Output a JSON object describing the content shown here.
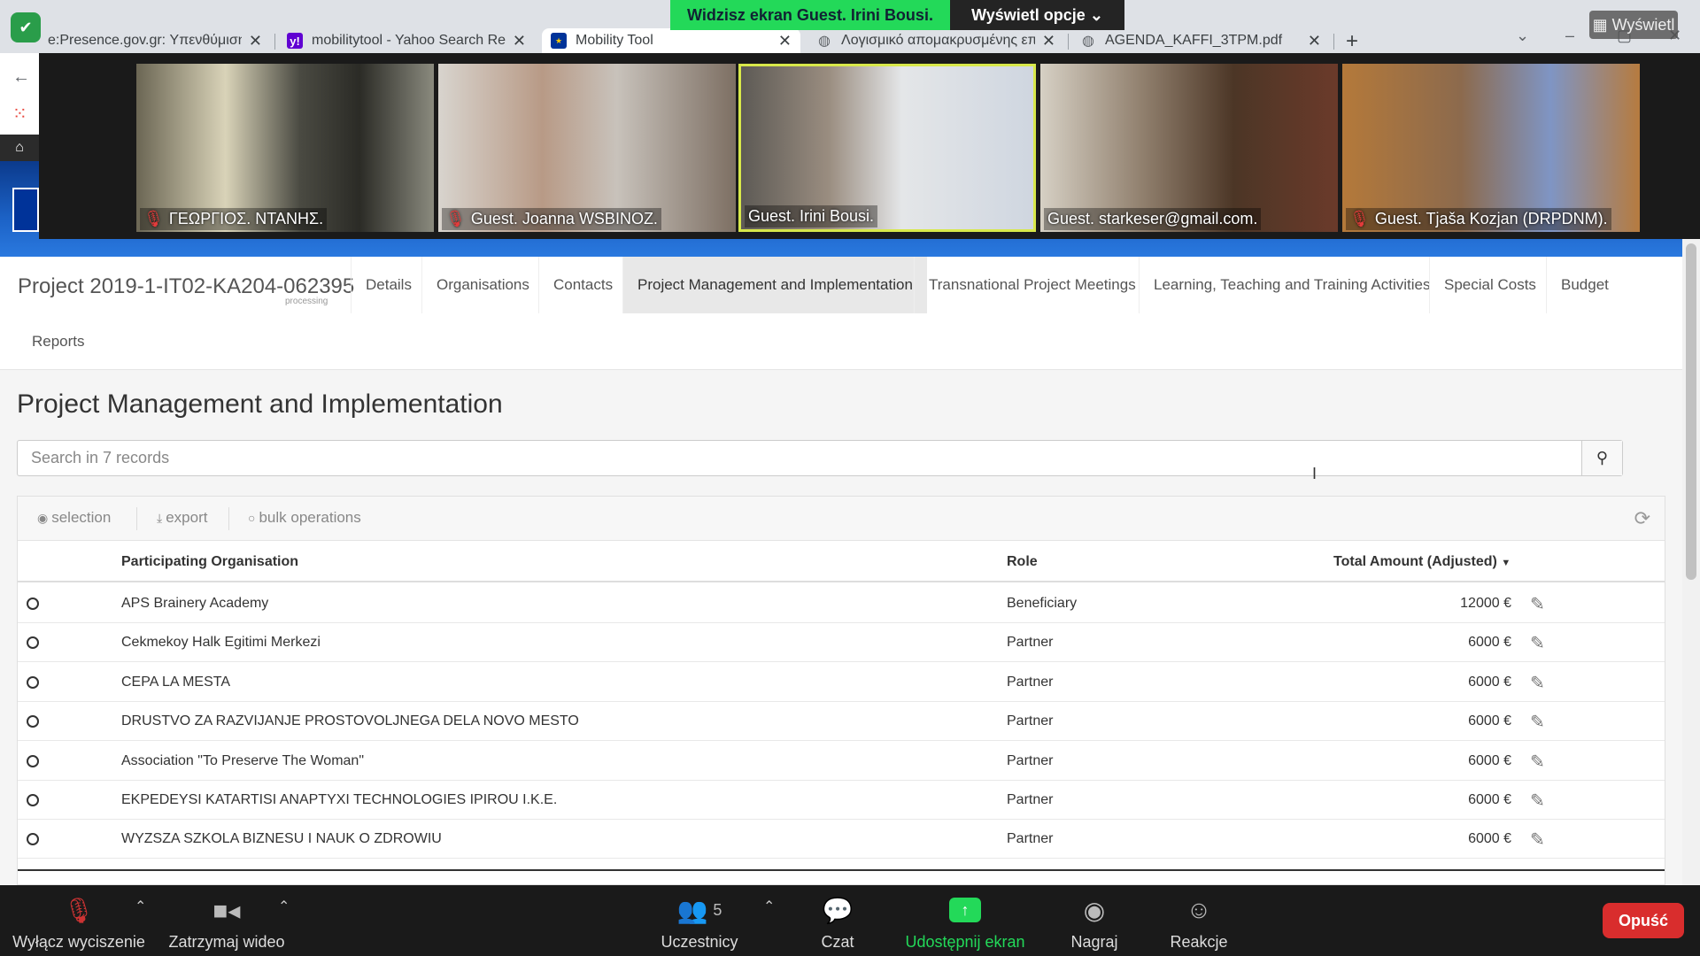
{
  "browser": {
    "tabs": [
      {
        "title": "e:Presence.gov.gr: Υπενθύμιση Π",
        "favicon": "shield-icon"
      },
      {
        "title": "mobilitytool - Yahoo Search Resu",
        "favicon": "yahoo-icon"
      },
      {
        "title": "Mobility Tool",
        "favicon": "eu-flag-icon"
      },
      {
        "title": "Λογισμικό απομακρυσμένης επι",
        "favicon": "globe-icon"
      },
      {
        "title": "AGENDA_KAFFI_3TPM.pdf",
        "favicon": "globe-icon"
      }
    ],
    "close_glyph": "✕",
    "new_tab_glyph": "+"
  },
  "zoom_top": {
    "share_banner": "Widzisz ekran Guest. Irini Bousi.",
    "view_options": "Wyświetl opcje",
    "view_button": "Wyświetl",
    "participants": [
      {
        "name": "ΓΕΩΡΓΙΟΣ. ΝΤΑΝΗΣ.",
        "muted": true
      },
      {
        "name": "Guest. Joanna WSBINOZ.",
        "muted": true
      },
      {
        "name": "Guest. Irini Bousi.",
        "muted": false
      },
      {
        "name": "Guest. starkeser@gmail.com.",
        "muted": false
      },
      {
        "name": "Guest. Tjaša Kozjan (DRPDNM).",
        "muted": true
      }
    ]
  },
  "project": {
    "title": "Project 2019-1-IT02-KA204-062395",
    "status": "processing",
    "tabs": [
      "Details",
      "Organisations",
      "Contacts",
      "Project Management and Implementation",
      "Transnational Project Meetings",
      "Learning, Teaching and Training Activities",
      "Special Costs",
      "Budget",
      "Reports"
    ],
    "active_tab": "Project Management and Implementation"
  },
  "main": {
    "page_title": "Project Management and Implementation",
    "search_placeholder": "Search in 7 records",
    "toolbar": {
      "selection": "selection",
      "export": "export",
      "bulk": "bulk operations"
    },
    "columns": {
      "org": "Participating Organisation",
      "role": "Role",
      "amount": "Total Amount (Adjusted)"
    },
    "rows": [
      {
        "org": "APS Brainery Academy",
        "role": "Beneficiary",
        "amount": "12000 €"
      },
      {
        "org": "Cekmekoy Halk Egitimi Merkezi",
        "role": "Partner",
        "amount": "6000 €"
      },
      {
        "org": "CEPA LA MESTA",
        "role": "Partner",
        "amount": "6000 €"
      },
      {
        "org": "DRUSTVO ZA RAZVIJANJE PROSTOVOLJNEGA DELA NOVO MESTO",
        "role": "Partner",
        "amount": "6000 €"
      },
      {
        "org": "Association \"To Preserve The Woman\"",
        "role": "Partner",
        "amount": "6000 €"
      },
      {
        "org": "EKPEDEYSI KATARTISI ANAPTYXI TECHNOLOGIES IPIROU I.K.E.",
        "role": "Partner",
        "amount": "6000 €"
      },
      {
        "org": "WYZSZA SZKOLA BIZNESU I NAUK O ZDROWIU",
        "role": "Partner",
        "amount": "6000 €"
      }
    ]
  },
  "zoom_bottom": {
    "mute": "Wyłącz wyciszenie",
    "video": "Zatrzymaj wideo",
    "participants": "Uczestnicy",
    "participants_count": "5",
    "chat": "Czat",
    "share": "Udostępnij ekran",
    "record": "Nagraj",
    "reactions": "Reakcje",
    "leave": "Opuść"
  },
  "colors": {
    "share_green": "#23d959",
    "leave_red": "#d92d2d",
    "speaker_border": "#d8e84a"
  }
}
